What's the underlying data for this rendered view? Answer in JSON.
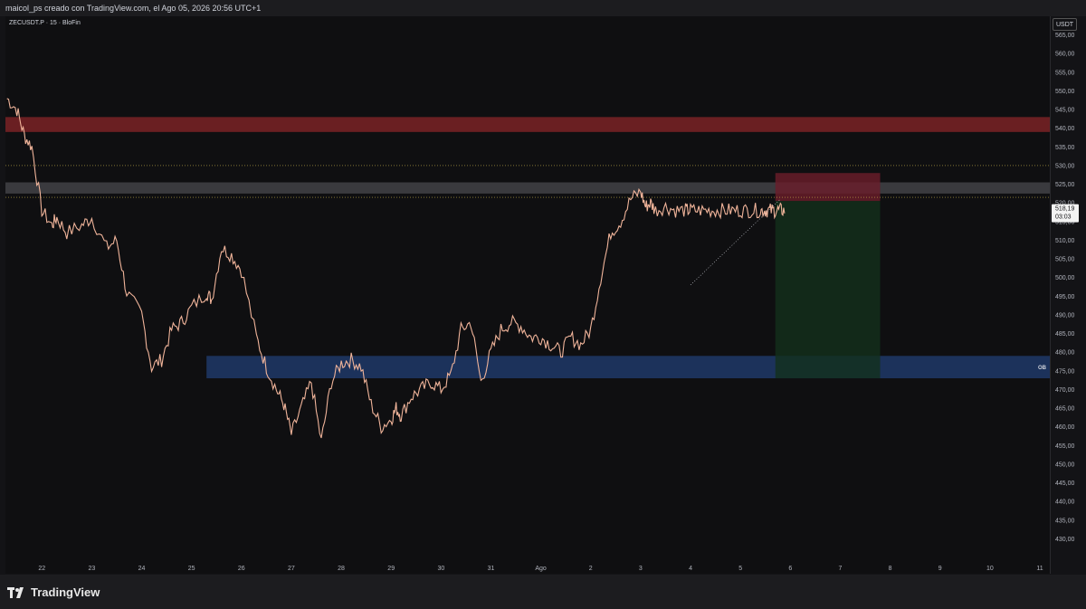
{
  "header": {
    "credit": "maicol_ps creado con TradingView.com, el Ago 05, 2026 20:56 UTC+1"
  },
  "symbol": {
    "label": "ZECUSDT.P · 15 · BloFin"
  },
  "price_axis": {
    "currency": "USDT",
    "last_price": "518,19",
    "countdown": "03:03"
  },
  "footer": {
    "brand": "TradingView"
  },
  "colors": {
    "candle": "#f0b49a",
    "resistance_zone": "#7a2226",
    "support_zone": "#1f3868",
    "gray_zone": "#4a4a4e",
    "stop_zone": "#6b1d2a",
    "target_zone": "#13301c",
    "dotted_line": "#c9b24a"
  },
  "chart_data": {
    "type": "line",
    "title": "",
    "xlabel": "",
    "ylabel": "",
    "ylim": [
      425,
      570
    ],
    "y_ticks": [
      "430,00",
      "435,00",
      "440,00",
      "445,00",
      "450,00",
      "455,00",
      "460,00",
      "465,00",
      "470,00",
      "475,00",
      "480,00",
      "485,00",
      "490,00",
      "495,00",
      "500,00",
      "505,00",
      "510,00",
      "515,00",
      "520,00",
      "525,00",
      "530,00",
      "535,00",
      "540,00",
      "545,00",
      "550,00",
      "555,00",
      "560,00",
      "565,00"
    ],
    "x_ticks": [
      "22",
      "23",
      "24",
      "25",
      "26",
      "27",
      "28",
      "29",
      "30",
      "31",
      "Ago",
      "2",
      "3",
      "4",
      "5",
      "6",
      "7",
      "8",
      "9",
      "10",
      "11"
    ],
    "x_tick_days": [
      1,
      2,
      3,
      4,
      5,
      6,
      7,
      8,
      9,
      10,
      11,
      12,
      13,
      14,
      15,
      16,
      17,
      18,
      19,
      20,
      21
    ],
    "x_range_days": [
      0.27,
      21.2
    ],
    "series": [
      {
        "x": [
          0.3,
          0.5,
          0.65,
          0.8,
          1.0,
          1.2,
          1.3,
          1.5,
          1.8,
          2.0,
          2.3,
          2.5,
          2.7,
          3.0,
          3.2,
          3.4,
          3.6,
          3.8,
          4.0,
          4.3,
          4.4,
          4.6,
          4.8,
          5.0,
          5.3,
          5.5,
          5.7,
          5.85,
          6.0,
          6.2,
          6.4,
          6.6,
          6.8,
          7.0,
          7.2,
          7.4,
          7.6,
          7.8,
          8.0,
          8.1,
          8.2,
          8.4,
          8.6,
          8.8,
          9.0,
          9.2,
          9.4,
          9.6,
          9.8,
          10.0,
          10.2,
          10.4,
          10.6,
          10.8,
          11.0,
          11.2,
          11.4,
          11.6,
          11.8,
          12.0,
          12.2,
          12.4,
          12.6,
          12.8,
          13.0,
          13.1,
          13.2,
          13.3,
          13.5,
          13.7,
          13.9,
          14.0,
          14.2,
          14.4,
          14.6,
          14.8,
          15.0,
          15.2,
          15.4,
          15.5,
          15.6,
          15.7,
          15.8,
          15.9
        ],
        "y": [
          548,
          545,
          538,
          535,
          518,
          514,
          516,
          512,
          514,
          516,
          508,
          510,
          496,
          490,
          476,
          478,
          486,
          488,
          492,
          496,
          494,
          508,
          506,
          502,
          484,
          476,
          470,
          466,
          458,
          465,
          472,
          456,
          472,
          477,
          478,
          476,
          466,
          460,
          462,
          465,
          463,
          468,
          470,
          472,
          470,
          474,
          486,
          488,
          472,
          480,
          486,
          488,
          487,
          484,
          484,
          482,
          480,
          484,
          482,
          486,
          500,
          512,
          515,
          521,
          523,
          519,
          520,
          518,
          519,
          518,
          518,
          518,
          518,
          518,
          518,
          518,
          518,
          518,
          518,
          518,
          518,
          518,
          518,
          518
        ],
        "values": [
          548,
          545,
          538,
          535,
          518,
          514,
          516,
          512,
          514,
          516,
          508,
          510,
          496,
          490,
          476,
          478,
          486,
          488,
          492,
          496,
          494,
          508,
          506,
          502,
          484,
          476,
          470,
          466,
          458,
          465,
          472,
          456,
          472,
          477,
          478,
          476,
          466,
          460,
          462,
          465,
          463,
          468,
          470,
          472,
          470,
          474,
          486,
          488,
          472,
          480,
          486,
          488,
          487,
          484,
          484,
          482,
          480,
          484,
          482,
          486,
          500,
          512,
          515,
          521,
          523,
          519,
          520,
          518,
          519,
          518,
          518,
          518,
          518,
          518,
          518,
          518,
          518,
          518,
          518,
          518,
          518,
          518,
          518,
          518
        ]
      }
    ],
    "zones": [
      {
        "name": "resistance",
        "y_low": 539,
        "y_high": 543,
        "x_from": 0.27,
        "x_to": 21.2,
        "label": ""
      },
      {
        "name": "gray-zone",
        "y_low": 522.5,
        "y_high": 525.5,
        "x_from": 0.27,
        "x_to": 21.2,
        "label": ""
      },
      {
        "name": "support",
        "y_low": 473,
        "y_high": 479,
        "x_from": 4.3,
        "x_to": 21.2,
        "label": "OB"
      },
      {
        "name": "stop",
        "y_low": 520.5,
        "y_high": 528,
        "x_from": 15.7,
        "x_to": 17.8,
        "label": ""
      },
      {
        "name": "target",
        "y_low": 473,
        "y_high": 520.5,
        "x_from": 15.7,
        "x_to": 17.8,
        "label": ""
      }
    ],
    "h_lines": [
      530,
      521.5
    ]
  }
}
